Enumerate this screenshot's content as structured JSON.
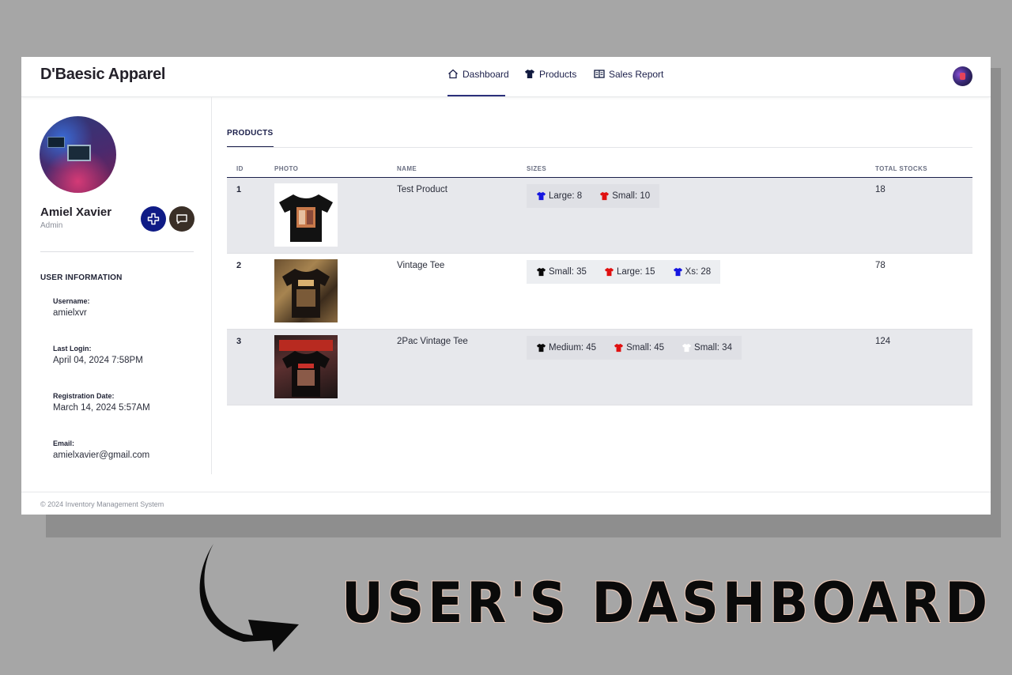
{
  "app": {
    "brand": "D'Baesic Apparel"
  },
  "nav": {
    "items": [
      {
        "label": "Dashboard",
        "icon": "home-icon",
        "active": true
      },
      {
        "label": "Products",
        "icon": "tshirt-icon",
        "active": false
      },
      {
        "label": "Sales Report",
        "icon": "report-icon",
        "active": false
      }
    ]
  },
  "profile": {
    "name": "Amiel Xavier",
    "role": "Admin",
    "add_button_icon": "add-icon",
    "chat_button_icon": "chat-icon"
  },
  "user_info": {
    "title": "USER INFORMATION",
    "fields": [
      {
        "label": "Username:",
        "value": "amielxvr"
      },
      {
        "label": "Last Login:",
        "value": "April 04, 2024 7:58PM"
      },
      {
        "label": "Registration Date:",
        "value": "March 14, 2024 5:57AM"
      },
      {
        "label": "Email:",
        "value": "amielxavier@gmail.com"
      }
    ]
  },
  "main": {
    "tab": "PRODUCTS",
    "columns": [
      "ID",
      "PHOTO",
      "NAME",
      "SIZES",
      "TOTAL STOCKS"
    ],
    "rows": [
      {
        "id": "1",
        "name": "Test Product",
        "total": "18",
        "sizes": [
          {
            "label": "Large: 8",
            "color": "#1515e0"
          },
          {
            "label": "Small: 10",
            "color": "#e01010"
          }
        ]
      },
      {
        "id": "2",
        "name": "Vintage Tee",
        "total": "78",
        "sizes": [
          {
            "label": "Small: 35",
            "color": "#0a0a0a"
          },
          {
            "label": "Large: 15",
            "color": "#e01010"
          },
          {
            "label": "Xs: 28",
            "color": "#1515e0"
          }
        ]
      },
      {
        "id": "3",
        "name": "2Pac Vintage Tee",
        "total": "124",
        "sizes": [
          {
            "label": "Medium: 45",
            "color": "#0a0a0a"
          },
          {
            "label": "Small: 45",
            "color": "#e01010"
          },
          {
            "label": "Small: 34",
            "color": "#ffffff"
          }
        ]
      }
    ]
  },
  "footer": {
    "text": "© 2024 Inventory Management System"
  },
  "caption": {
    "text": "USER'S DASHBOARD"
  },
  "colors": {
    "accent": "#1b1f4a",
    "add_button": "#0f1b86",
    "chat_button": "#3a2f27",
    "row_shade": "#e7e8ec"
  }
}
